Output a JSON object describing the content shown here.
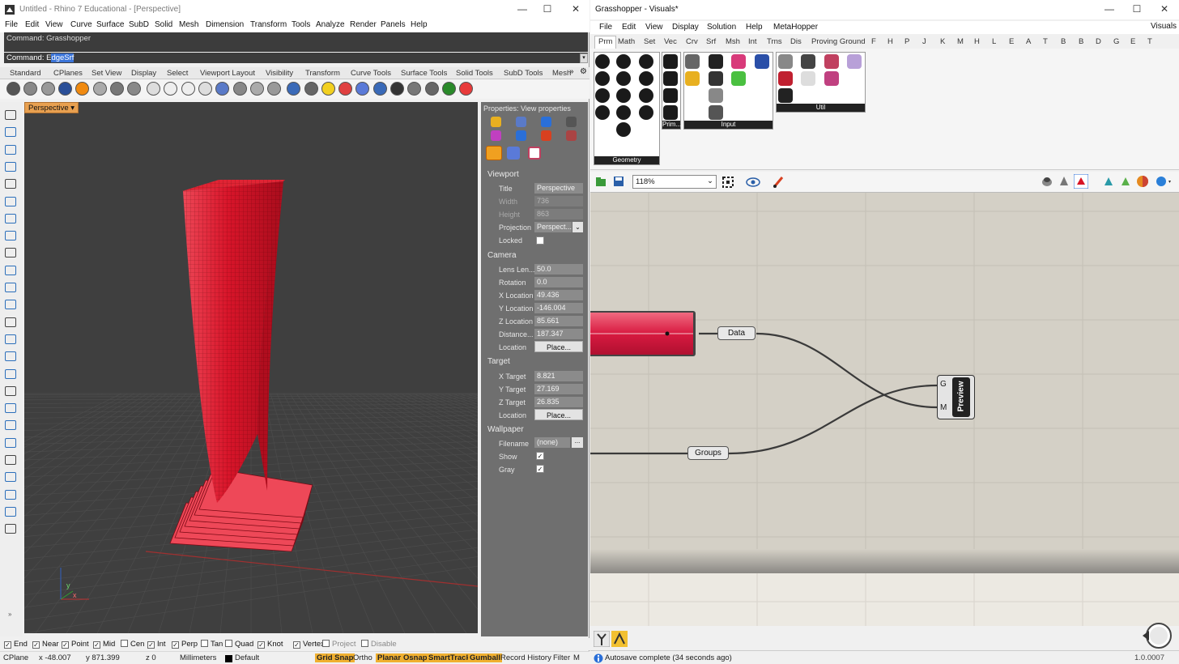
{
  "rhino": {
    "title": "Untitled - Rhino 7 Educational - [Perspective]",
    "menu": [
      "File",
      "Edit",
      "View",
      "Curve",
      "Surface",
      "SubD",
      "Solid",
      "Mesh",
      "Dimension",
      "Transform",
      "Tools",
      "Analyze",
      "Render",
      "Panels",
      "Help"
    ],
    "command_history": "Command: Grasshopper",
    "command_prompt": "Command: ",
    "command_first_letter": "E",
    "command_selected": "dgeSrf",
    "tabs": [
      "Standard",
      "CPlanes",
      "Set View",
      "Display",
      "Select",
      "Viewport Layout",
      "Visibility",
      "Transform",
      "Curve Tools",
      "Surface Tools",
      "Solid Tools",
      "SubD Tools",
      "Mesh"
    ],
    "viewport_label": "Perspective",
    "properties": {
      "header": "Properties: View properties",
      "viewport_section": "Viewport",
      "title_label": "Title",
      "title_value": "Perspective",
      "width_label": "Width",
      "width_value": "736",
      "height_label": "Height",
      "height_value": "863",
      "projection_label": "Projection",
      "projection_value": "Perspect...",
      "locked_label": "Locked",
      "camera_section": "Camera",
      "lens_label": "Lens Len...",
      "lens_value": "50.0",
      "rotation_label": "Rotation",
      "rotation_value": "0.0",
      "xloc_label": "X Location",
      "xloc_value": "49.436",
      "yloc_label": "Y Location",
      "yloc_value": "-146.004",
      "zloc_label": "Z Location",
      "zloc_value": "85.661",
      "distance_label": "Distance...",
      "distance_value": "187.347",
      "location_label": "Location",
      "place_button": "Place...",
      "target_section": "Target",
      "xt_label": "X Target",
      "xt_value": "8.821",
      "yt_label": "Y Target",
      "yt_value": "27.169",
      "zt_label": "Z Target",
      "zt_value": "26.835",
      "tlocation_label": "Location",
      "wallpaper_section": "Wallpaper",
      "filename_label": "Filename",
      "filename_value": "(none)",
      "filename_btn": "...",
      "show_label": "Show",
      "gray_label": "Gray"
    },
    "osnaps": [
      {
        "label": "End",
        "checked": true
      },
      {
        "label": "Near",
        "checked": true
      },
      {
        "label": "Point",
        "checked": true
      },
      {
        "label": "Mid",
        "checked": true
      },
      {
        "label": "Cen",
        "checked": false
      },
      {
        "label": "Int",
        "checked": true
      },
      {
        "label": "Perp",
        "checked": true
      },
      {
        "label": "Tan",
        "checked": false
      },
      {
        "label": "Quad",
        "checked": false
      },
      {
        "label": "Knot",
        "checked": true
      },
      {
        "label": "Vertex",
        "checked": true
      },
      {
        "label": "Project",
        "checked": false
      },
      {
        "label": "Disable",
        "checked": false
      }
    ],
    "status": {
      "cplane": "CPlane",
      "x": "x -48.007",
      "y": "y 871.399",
      "z": "z 0",
      "units": "Millimeters",
      "layer": "Default",
      "grid_snap": "Grid Snap",
      "ortho": "Ortho",
      "planar": "Planar",
      "osnap": "Osnap",
      "smarttrack": "SmartTrack",
      "gumball": "Gumball",
      "record_history": "Record History",
      "filter": "Filter",
      "overflow": "M"
    },
    "axis_x": "x",
    "axis_y": "y"
  },
  "grasshopper": {
    "title": "Grasshopper - Visuals*",
    "menu": [
      "File",
      "Edit",
      "View",
      "Display",
      "Solution",
      "Help",
      "MetaHopper"
    ],
    "doc_name": "Visuals",
    "tabs": [
      "Prm",
      "Math",
      "Set",
      "Vec",
      "Crv",
      "Srf",
      "Msh",
      "Int",
      "Trns",
      "Dis",
      "Proving Ground",
      "F",
      "H",
      "P",
      "J",
      "K",
      "M",
      "H",
      "L",
      "E",
      "A",
      "T",
      "B",
      "B",
      "D",
      "G",
      "E",
      "T"
    ],
    "panels": [
      "Geometry",
      "Prim...",
      "Input",
      "Util"
    ],
    "zoom": "118%",
    "nodes": {
      "data": "Data",
      "groups": "Groups",
      "preview": "Preview",
      "input_g": "G",
      "input_m": "M"
    },
    "status": "Autosave complete (34 seconds ago)",
    "version": "1.0.0007"
  },
  "colors": {
    "tower": "#d8152a",
    "tower_light": "#ee4858",
    "viewport_bg": "#3f3f3f",
    "canvas_bg": "#d4d0c6",
    "accent_orange": "#f0b030"
  }
}
